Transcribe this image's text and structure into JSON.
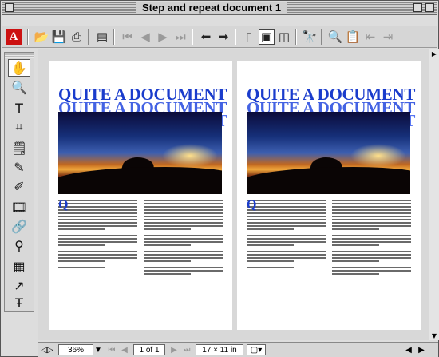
{
  "window": {
    "title": "Step and repeat document 1"
  },
  "toolbar": {
    "buttons": [
      "acrobat-logo",
      "open-icon",
      "save-icon",
      "print-icon",
      "show-hide-navigation-icon",
      "first-page-icon",
      "previous-page-icon",
      "next-page-icon",
      "last-page-icon",
      "go-back-icon",
      "go-forward-icon",
      "single-page-icon",
      "continuous-icon",
      "continuous-facing-icon",
      "find-icon",
      "search-icon",
      "search-results-icon",
      "previous-highlight-icon",
      "next-highlight-icon"
    ]
  },
  "palette": {
    "tools": [
      "hand-tool-icon",
      "zoom-tool-icon",
      "text-select-tool-icon",
      "crop-tool-icon",
      "notes-tool-icon",
      "pencil-tool-icon",
      "highlight-tool-icon",
      "movie-tool-icon",
      "link-tool-icon",
      "article-tool-icon",
      "form-tool-icon",
      "touchup-object-tool-icon",
      "touchup-text-tool-icon"
    ]
  },
  "document": {
    "pages": [
      {
        "heading": "QUITE A DOCUMENT"
      },
      {
        "heading": "QUITE A DOCUMENT"
      }
    ]
  },
  "status": {
    "zoom": "36%",
    "page_indicator": "1 of 1",
    "page_size": "17 × 11 in"
  },
  "colors": {
    "heading": "#1a3ccc",
    "acrobat_red": "#cc1111"
  }
}
